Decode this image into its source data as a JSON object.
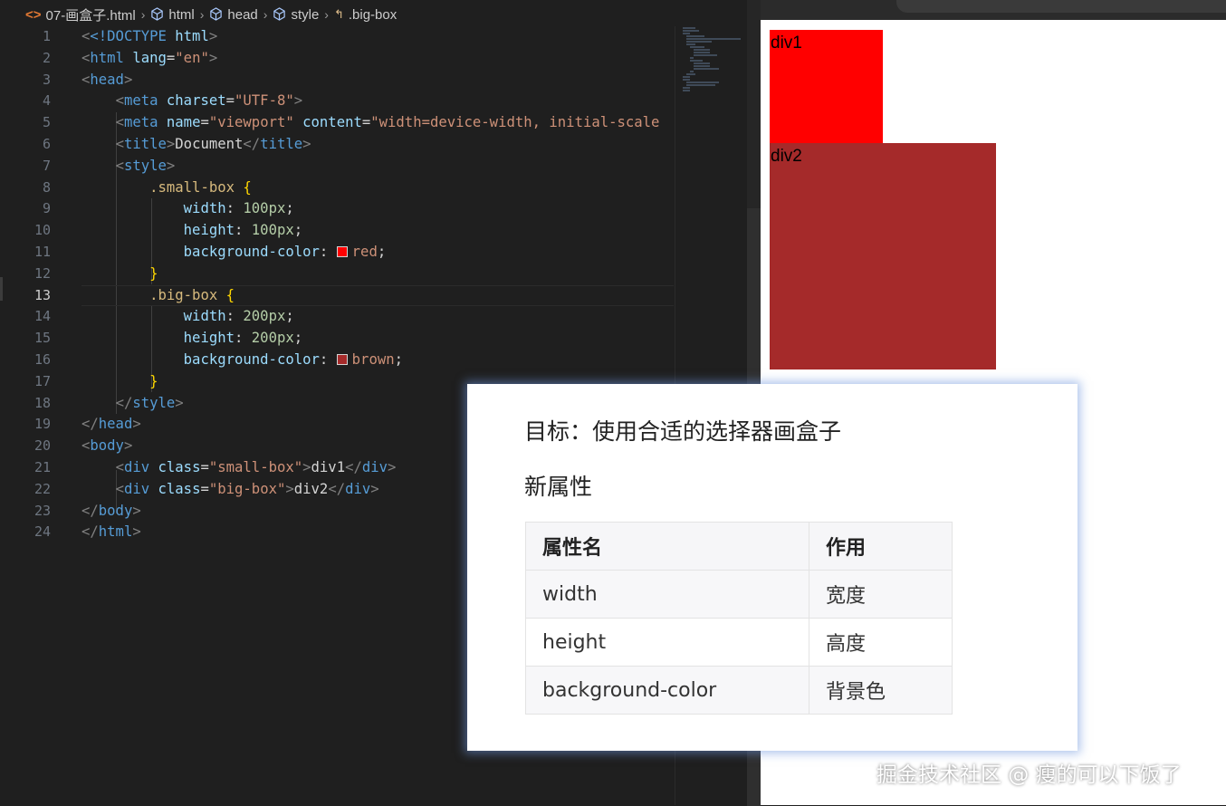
{
  "breadcrumb": {
    "file": "07-画盒子.html",
    "html": "html",
    "head": "head",
    "style": "style",
    "selector": ".big-box"
  },
  "line_numbers": [
    "1",
    "2",
    "3",
    "4",
    "5",
    "6",
    "7",
    "8",
    "9",
    "10",
    "11",
    "12",
    "13",
    "14",
    "15",
    "16",
    "17",
    "18",
    "19",
    "20",
    "21",
    "22",
    "23",
    "24"
  ],
  "current_line": "13",
  "code": {
    "l1": [
      "<!DOCTYPE",
      " html",
      ">"
    ],
    "l2_tag": "html",
    "l2_attr": "lang",
    "l2_val": "\"en\"",
    "l3_tag": "head",
    "l4_tag": "meta",
    "l4_attr": "charset",
    "l4_val": "\"UTF-8\"",
    "l5_tag": "meta",
    "l5_attr1": "name",
    "l5_val1": "\"viewport\"",
    "l5_attr2": "content",
    "l5_val2": "\"width=device-width, initial-scale",
    "l6_tag": "title",
    "l6_text": "Document",
    "l7_tag": "style",
    "l8_sel": ".small-box",
    "l9_prop": "width",
    "l9_val": "100px",
    "l10_prop": "height",
    "l10_val": "100px",
    "l11_prop": "background-color",
    "l11_val": "red",
    "l13_sel": ".big-box",
    "l14_prop": "width",
    "l14_val": "200px",
    "l15_prop": "height",
    "l15_val": "200px",
    "l16_prop": "background-color",
    "l16_val": "brown",
    "l18_tag": "style",
    "l19_tag": "head",
    "l20_tag": "body",
    "l21_tag": "div",
    "l21_attr": "class",
    "l21_val": "\"small-box\"",
    "l21_text": "div1",
    "l22_tag": "div",
    "l22_attr": "class",
    "l22_val": "\"big-box\"",
    "l22_text": "div2",
    "l23_tag": "body",
    "l24_tag": "html"
  },
  "colors": {
    "red": "#ff0000",
    "brown": "#a52a2a"
  },
  "preview": {
    "div1": "div1",
    "div2": "div2"
  },
  "card": {
    "title": "目标：使用合适的选择器画盒子",
    "subtitle": "新属性",
    "headers": [
      "属性名",
      "作用"
    ],
    "rows": [
      [
        "width",
        "宽度"
      ],
      [
        "height",
        "高度"
      ],
      [
        "background-color",
        "背景色"
      ]
    ]
  },
  "watermark": "掘金技术社区 @ 瘦的可以下饭了"
}
